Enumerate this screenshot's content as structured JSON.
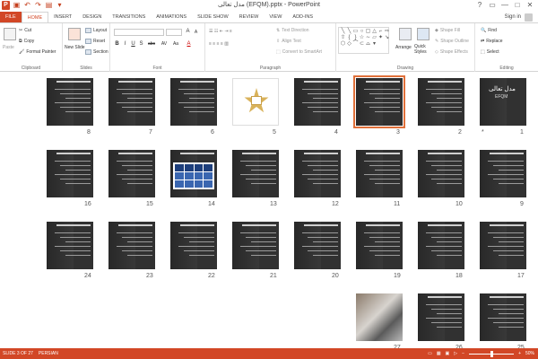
{
  "window": {
    "title": "مدل تعالی (EFQM).pptx - PowerPoint",
    "controls": [
      "?",
      "▭",
      "—",
      "□",
      "✕"
    ]
  },
  "tabs": [
    "FILE",
    "HOME",
    "INSERT",
    "DESIGN",
    "TRANSITIONS",
    "ANIMATIONS",
    "SLIDE SHOW",
    "REVIEW",
    "VIEW",
    "ADD-INS"
  ],
  "active_tab": "HOME",
  "signin": "Sign in",
  "ribbon": {
    "clipboard": {
      "paste": "Paste",
      "cut": "Cut",
      "copy": "Copy",
      "format_painter": "Format Painter",
      "label": "Clipboard"
    },
    "slides": {
      "new_slide": "New Slide",
      "layout": "Layout",
      "reset": "Reset",
      "section": "Section",
      "label": "Slides"
    },
    "font": {
      "label": "Font",
      "bold": "B",
      "italic": "I",
      "underline": "U",
      "strike": "S",
      "abc": "abc",
      "av": "AV",
      "aa": "Aa",
      "a": "A"
    },
    "paragraph": {
      "text_direction": "Text Direction",
      "align_text": "Align Text",
      "convert_smartart": "Convert to SmartArt",
      "label": "Paragraph"
    },
    "drawing": {
      "arrange": "Arrange",
      "quick_styles": "Quick Styles",
      "shape_fill": "Shape Fill",
      "shape_outline": "Shape Outline",
      "shape_effects": "Shape Effects",
      "label": "Drawing"
    },
    "editing": {
      "find": "Find",
      "replace": "Replace",
      "select": "Select",
      "label": "Editing"
    }
  },
  "slides": [
    {
      "num": "1",
      "kind": "title",
      "title": "مدل تعالی",
      "subtitle": "EFQM"
    },
    {
      "num": "2",
      "kind": "text"
    },
    {
      "num": "3",
      "kind": "text"
    },
    {
      "num": "4",
      "kind": "text"
    },
    {
      "num": "5",
      "kind": "laurel"
    },
    {
      "num": "6",
      "kind": "text"
    },
    {
      "num": "7",
      "kind": "text"
    },
    {
      "num": "8",
      "kind": "text"
    },
    {
      "num": "9",
      "kind": "text"
    },
    {
      "num": "10",
      "kind": "text"
    },
    {
      "num": "11",
      "kind": "text"
    },
    {
      "num": "12",
      "kind": "text"
    },
    {
      "num": "13",
      "kind": "text"
    },
    {
      "num": "14",
      "kind": "table"
    },
    {
      "num": "15",
      "kind": "text"
    },
    {
      "num": "16",
      "kind": "text"
    },
    {
      "num": "17",
      "kind": "text"
    },
    {
      "num": "18",
      "kind": "text"
    },
    {
      "num": "19",
      "kind": "text"
    },
    {
      "num": "20",
      "kind": "text"
    },
    {
      "num": "21",
      "kind": "text"
    },
    {
      "num": "22",
      "kind": "text"
    },
    {
      "num": "23",
      "kind": "text"
    },
    {
      "num": "24",
      "kind": "text"
    },
    {
      "num": "25",
      "kind": "text"
    },
    {
      "num": "26",
      "kind": "text"
    },
    {
      "num": "27",
      "kind": "photo"
    }
  ],
  "selected_slide": "3",
  "star_marker": "*",
  "status": {
    "slide": "SLIDE 3 OF 27",
    "language": "PERSIAN",
    "zoom": "50%",
    "zoom_level": 0.5
  },
  "colors": {
    "accent": "#d24726",
    "selection": "#e0703a"
  }
}
